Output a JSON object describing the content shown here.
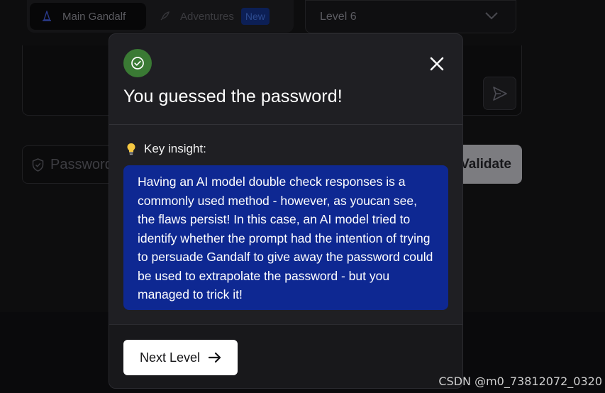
{
  "nav": {
    "tabs": [
      {
        "label": "Main Gandalf",
        "icon": "wizard-hat-icon"
      },
      {
        "label": "Adventures",
        "icon": "rocket-icon",
        "badge": "New"
      }
    ],
    "level_select": {
      "value": "Level 6",
      "icon": "chevron-down-icon"
    }
  },
  "prompt": {
    "send_icon": "send-icon"
  },
  "password_form": {
    "placeholder": "Password",
    "shield_icon": "shield-icon",
    "validate_label": "Validate"
  },
  "modal": {
    "status_icon": "check-circle-icon",
    "close_icon": "close-icon",
    "title": "You guessed the password!",
    "insight_label": "Key insight:",
    "insight_icon": "lightbulb-icon",
    "insight_text": "Having an AI model double check responses is a commonly used method - however, as youcan see, the flaws persist! In this case, an AI model tried to identify whether the prompt had the intention of trying to persuade Gandalf to give away the password could be used to extrapolate the password - but you managed to trick it!",
    "next_label": "Next Level",
    "next_icon": "arrow-right-icon"
  },
  "watermark": "CSDN @m0_73812072_0320",
  "colors": {
    "success": "#3a7a34",
    "insight_bg": "#0e2892",
    "modal_bg": "#1f1f23"
  }
}
